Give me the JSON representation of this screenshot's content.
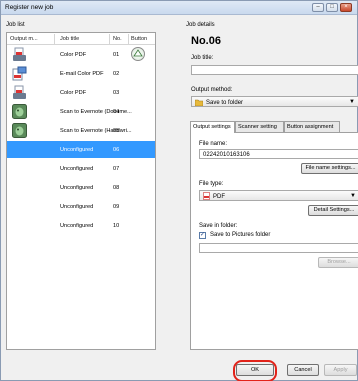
{
  "window": {
    "title": "Register new job"
  },
  "job_list": {
    "label": "Job list",
    "columns": [
      "Output m...",
      "Job title",
      "No.",
      "Button"
    ],
    "rows": [
      {
        "title": "Color PDF",
        "no": "01",
        "icon": "scanner-pdf-icon",
        "button": true
      },
      {
        "title": "E-mail Color PDF",
        "no": "02",
        "icon": "email-pdf-icon",
        "button": false
      },
      {
        "title": "Color PDF",
        "no": "03",
        "icon": "scanner-pdf-icon",
        "button": false
      },
      {
        "title": "Scan to Evernote (Docume...",
        "no": "04",
        "icon": "evernote-icon",
        "button": false
      },
      {
        "title": "Scan to Evernote (Handwri...",
        "no": "05",
        "icon": "evernote-icon",
        "button": false
      },
      {
        "title": "Unconfigured",
        "no": "06",
        "icon": "",
        "button": false
      },
      {
        "title": "Unconfigured",
        "no": "07",
        "icon": "",
        "button": false
      },
      {
        "title": "Unconfigured",
        "no": "08",
        "icon": "",
        "button": false
      },
      {
        "title": "Unconfigured",
        "no": "09",
        "icon": "",
        "button": false
      },
      {
        "title": "Unconfigured",
        "no": "10",
        "icon": "",
        "button": false
      }
    ],
    "selected_index": 5
  },
  "job_details": {
    "label": "Job details",
    "number": "No.06",
    "job_title_label": "Job title:",
    "job_title_value": "",
    "output_method_label": "Output method:",
    "output_method_value": "Save to folder",
    "tabs": [
      "Output settings",
      "Scanner setting",
      "Button assignment"
    ],
    "active_tab": 0,
    "file_name_label": "File name:",
    "file_name_value": "02242010163106",
    "file_name_settings_button": "File name settings...",
    "file_type_label": "File type:",
    "file_type_value": "PDF",
    "detail_settings_button": "Detail Settings...",
    "save_in_folder_label": "Save in folder:",
    "save_to_pictures_label": "Save to Pictures folder",
    "save_to_pictures_checked": true,
    "folder_path_value": "",
    "browse_button": "Browse..."
  },
  "footer": {
    "ok": "OK",
    "cancel": "Cancel",
    "apply": "Apply"
  },
  "colors": {
    "selection": "#3399ff",
    "highlight_ring": "#e2231a"
  }
}
